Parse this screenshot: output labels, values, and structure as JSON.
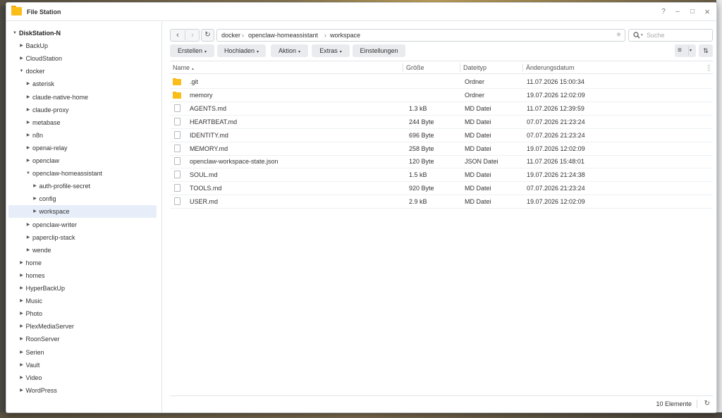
{
  "window": {
    "title": "File Station",
    "controls": {
      "help": "?",
      "minimize": "–",
      "maximize": "□",
      "close": "×"
    }
  },
  "sidebar": {
    "items": [
      {
        "label": "DiskStation-N",
        "level": 0,
        "expanded": true,
        "root": true
      },
      {
        "label": "BackUp",
        "level": 1,
        "expanded": false
      },
      {
        "label": "CloudStation",
        "level": 1,
        "expanded": false
      },
      {
        "label": "docker",
        "level": 1,
        "expanded": true
      },
      {
        "label": "asterisk",
        "level": 2,
        "expanded": false
      },
      {
        "label": "claude-native-home",
        "level": 2,
        "expanded": false
      },
      {
        "label": "claude-proxy",
        "level": 2,
        "expanded": false
      },
      {
        "label": "metabase",
        "level": 2,
        "expanded": false
      },
      {
        "label": "n8n",
        "level": 2,
        "expanded": false
      },
      {
        "label": "openai-relay",
        "level": 2,
        "expanded": false
      },
      {
        "label": "openclaw",
        "level": 2,
        "expanded": false
      },
      {
        "label": "openclaw-homeassistant",
        "level": 2,
        "expanded": true
      },
      {
        "label": "auth-profile-secret",
        "level": 3,
        "expanded": false
      },
      {
        "label": "config",
        "level": 3,
        "expanded": false
      },
      {
        "label": "workspace",
        "level": 3,
        "expanded": false,
        "selected": true
      },
      {
        "label": "openclaw-writer",
        "level": 2,
        "expanded": false
      },
      {
        "label": "paperclip-stack",
        "level": 2,
        "expanded": false
      },
      {
        "label": "wende",
        "level": 2,
        "expanded": false
      },
      {
        "label": "home",
        "level": 1,
        "expanded": false
      },
      {
        "label": "homes",
        "level": 1,
        "expanded": false
      },
      {
        "label": "HyperBackUp",
        "level": 1,
        "expanded": false
      },
      {
        "label": "Music",
        "level": 1,
        "expanded": false
      },
      {
        "label": "Photo",
        "level": 1,
        "expanded": false
      },
      {
        "label": "PlexMediaServer",
        "level": 1,
        "expanded": false
      },
      {
        "label": "RoonServer",
        "level": 1,
        "expanded": false
      },
      {
        "label": "Serien",
        "level": 1,
        "expanded": false
      },
      {
        "label": "Vault",
        "level": 1,
        "expanded": false
      },
      {
        "label": "Video",
        "level": 1,
        "expanded": false
      },
      {
        "label": "WordPress",
        "level": 1,
        "expanded": false
      }
    ]
  },
  "toolbar": {
    "back_icon": "‹",
    "forward_icon": "›",
    "refresh_icon": "↻",
    "breadcrumb": [
      "docker",
      "openclaw-homeassistant",
      "workspace"
    ],
    "breadcrumb_sep": "›",
    "favorite_icon": "★",
    "search_placeholder": "Suche",
    "buttons": [
      {
        "label": "Erstellen",
        "dropdown": true
      },
      {
        "label": "Hochladen",
        "dropdown": true
      },
      {
        "label": "Aktion",
        "dropdown": true
      },
      {
        "label": "Extras",
        "dropdown": true
      },
      {
        "label": "Einstellungen",
        "dropdown": false
      }
    ],
    "caret": "▾",
    "view_icon": "≡",
    "sort_icon": "⇅"
  },
  "table": {
    "columns": [
      "Name",
      "Größe",
      "Dateityp",
      "Änderungsdatum"
    ],
    "sort_indicator": "▲",
    "more_icon": "⋮",
    "rows": [
      {
        "name": ".git",
        "size": "",
        "type": "Ordner",
        "modified": "11.07.2026 15:00:34",
        "kind": "folder"
      },
      {
        "name": "memory",
        "size": "",
        "type": "Ordner",
        "modified": "19.07.2026 12:02:09",
        "kind": "folder"
      },
      {
        "name": "AGENTS.md",
        "size": "1.3 kB",
        "type": "MD Datei",
        "modified": "11.07.2026 12:39:59",
        "kind": "file"
      },
      {
        "name": "HEARTBEAT.md",
        "size": "244 Byte",
        "type": "MD Datei",
        "modified": "07.07.2026 21:23:24",
        "kind": "file"
      },
      {
        "name": "IDENTITY.md",
        "size": "696 Byte",
        "type": "MD Datei",
        "modified": "07.07.2026 21:23:24",
        "kind": "file"
      },
      {
        "name": "MEMORY.md",
        "size": "258 Byte",
        "type": "MD Datei",
        "modified": "19.07.2026 12:02:09",
        "kind": "file"
      },
      {
        "name": "openclaw-workspace-state.json",
        "size": "120 Byte",
        "type": "JSON Datei",
        "modified": "11.07.2026 15:48:01",
        "kind": "file"
      },
      {
        "name": "SOUL.md",
        "size": "1.5 kB",
        "type": "MD Datei",
        "modified": "19.07.2026 21:24:38",
        "kind": "file"
      },
      {
        "name": "TOOLS.md",
        "size": "920 Byte",
        "type": "MD Datei",
        "modified": "07.07.2026 21:23:24",
        "kind": "file"
      },
      {
        "name": "USER.md",
        "size": "2.9 kB",
        "type": "MD Datei",
        "modified": "19.07.2026 12:02:09",
        "kind": "file"
      }
    ]
  },
  "status": {
    "count": "10 Elemente",
    "refresh_icon": "↻"
  },
  "colors": {
    "folder": "#fbbe19",
    "selected_row": "#e7eef9",
    "button_bg": "#e9ebee"
  }
}
